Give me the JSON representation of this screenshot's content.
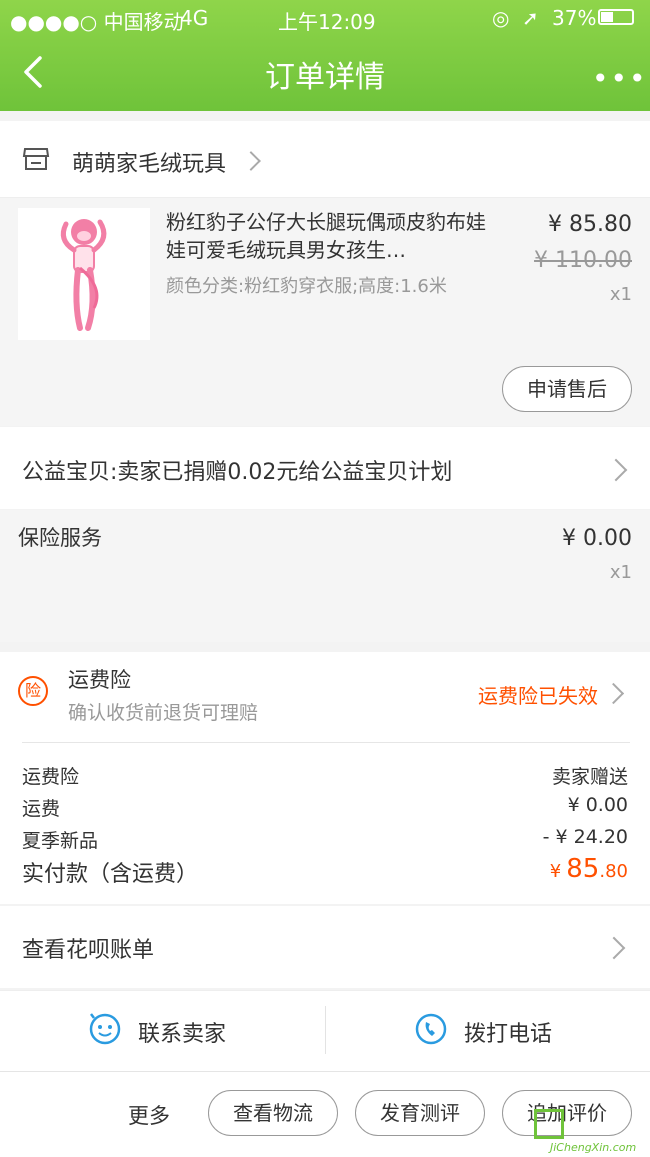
{
  "status_bar": {
    "carrier": "●●●●○ 中国移动",
    "network": "4G",
    "time": "上午12:09",
    "battery": "37%"
  },
  "nav": {
    "title": "订单详情",
    "more": "•••"
  },
  "store": {
    "name": "萌萌家毛绒玩具"
  },
  "product": {
    "title": "粉红豹子公仔大长腿玩偶顽皮豹布娃娃可爱毛绒玩具男女孩生…",
    "sku": "颜色分类:粉红豹穿衣服;高度:1.6米",
    "price": "¥ 85.80",
    "original_price": "¥ 110.00",
    "qty": "x1",
    "after_sale_button": "申请售后"
  },
  "charity": {
    "text": "公益宝贝:卖家已捐赠0.02元给公益宝贝计划"
  },
  "insurance_service": {
    "label": "保险服务",
    "price": "¥ 0.00",
    "qty": "x1"
  },
  "freight_insurance": {
    "icon_text": "险",
    "title": "运费险",
    "subtitle": "确认收货前退货可理赔",
    "status": "运费险已失效"
  },
  "pricing": {
    "rows": [
      {
        "label": "运费险",
        "value": "卖家赠送"
      },
      {
        "label": "运费",
        "value": "¥ 0.00"
      },
      {
        "label": "夏季新品",
        "value": "- ¥ 24.20"
      }
    ],
    "total_label": "实付款（含运费）",
    "total_currency": "¥",
    "total_int": "85",
    "total_dec": ".80"
  },
  "huabei": {
    "text": "查看花呗账单"
  },
  "contact": {
    "seller": "联系卖家",
    "phone": "拨打电话"
  },
  "bottom_bar": {
    "more": "更多",
    "logistics": "查看物流",
    "review": "发育测评",
    "add_review": "追加评价"
  },
  "watermark": {
    "text": "JiChengXin.com"
  },
  "colors": {
    "green": "#6fc33a",
    "orange": "#ff5000",
    "blue": "#2a9be0"
  }
}
